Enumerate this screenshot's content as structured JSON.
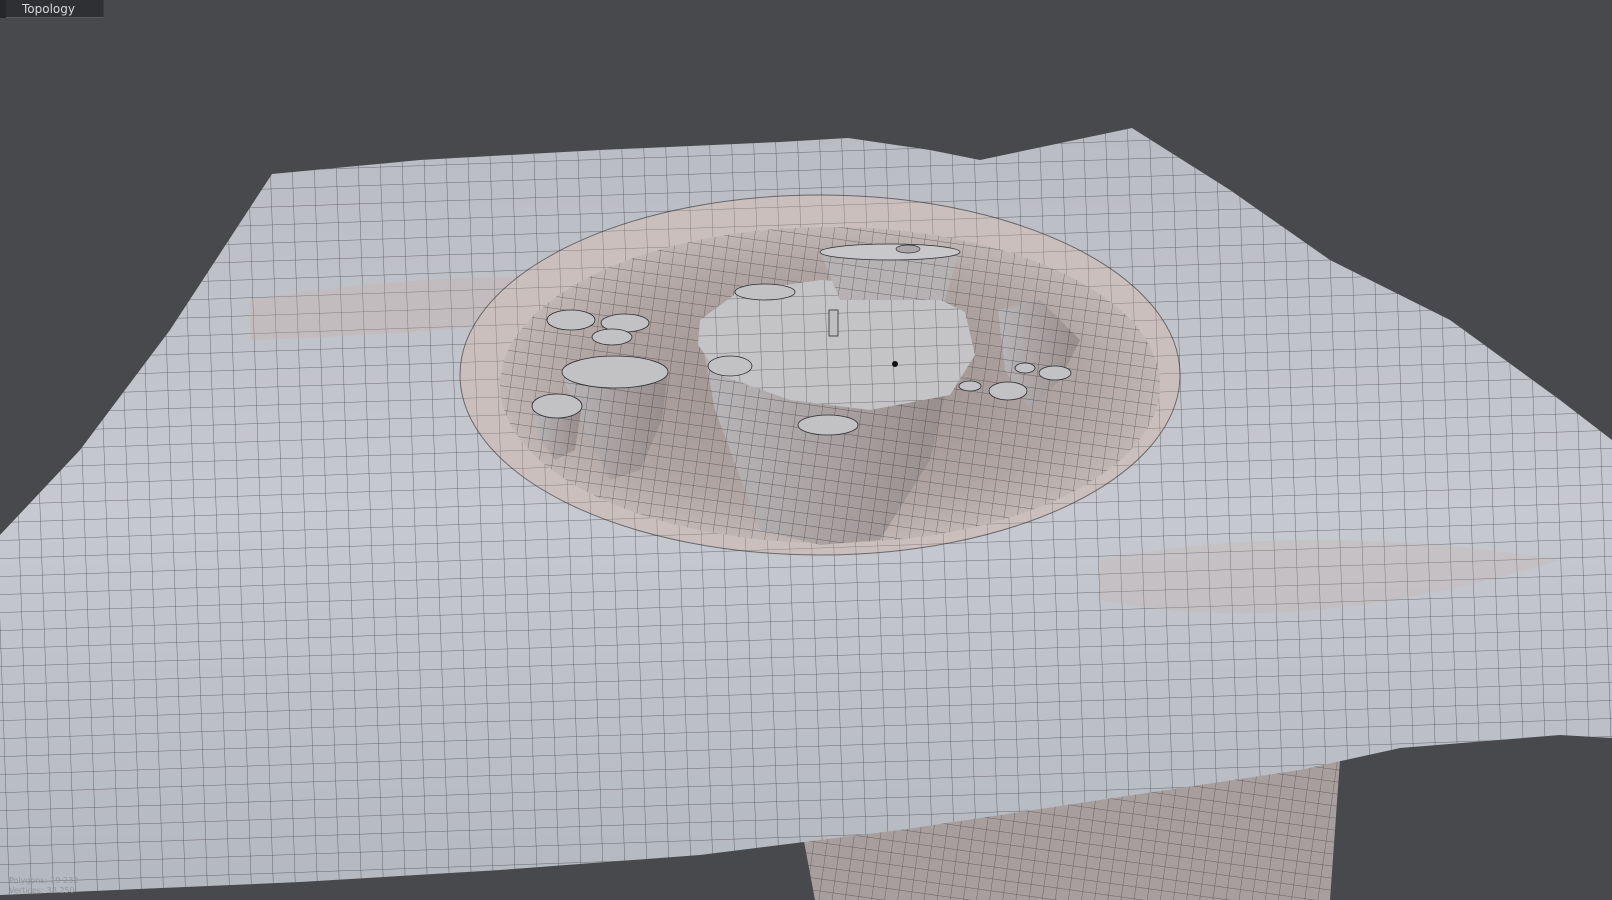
{
  "viewport": {
    "title": "Topology",
    "background_color": "#47494d",
    "mesh_color": "#c3c6cc",
    "mesh_shadow_color": "#b7aaa7",
    "wire_color": "#2c2c30",
    "stats": {
      "polygons_label": "Polygons:",
      "polygons_value": "19 232",
      "vertices_label": "Vertices:",
      "vertices_value": "38 250"
    }
  }
}
